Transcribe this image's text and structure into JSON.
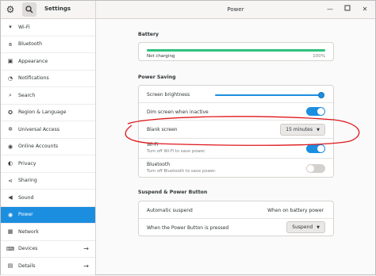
{
  "app_title": "Settings",
  "page_title": "Power",
  "sidebar": {
    "items": [
      {
        "label": "Wi-Fi",
        "icon": "wifi-icon",
        "glyph": "▾",
        "arrow": false,
        "active": false
      },
      {
        "label": "Bluetooth",
        "icon": "bluetooth-icon",
        "glyph": "ʙ",
        "arrow": false,
        "active": false
      },
      {
        "label": "Appearance",
        "icon": "appearance-icon",
        "glyph": "▣",
        "arrow": false,
        "active": false
      },
      {
        "label": "Notifications",
        "icon": "bell-icon",
        "glyph": "◔",
        "arrow": false,
        "active": false
      },
      {
        "label": "Search",
        "icon": "search-icon",
        "glyph": "⌕",
        "arrow": false,
        "active": false
      },
      {
        "label": "Region & Language",
        "icon": "region-icon",
        "glyph": "✪",
        "arrow": false,
        "active": false
      },
      {
        "label": "Universal Access",
        "icon": "accessibility-icon",
        "glyph": "✲",
        "arrow": false,
        "active": false
      },
      {
        "label": "Online Accounts",
        "icon": "online-accounts-icon",
        "glyph": "◉",
        "arrow": false,
        "active": false
      },
      {
        "label": "Privacy",
        "icon": "privacy-icon",
        "glyph": "◐",
        "arrow": false,
        "active": false
      },
      {
        "label": "Sharing",
        "icon": "sharing-icon",
        "glyph": "⋖",
        "arrow": false,
        "active": false
      },
      {
        "label": "Sound",
        "icon": "speaker-icon",
        "glyph": "◀",
        "arrow": false,
        "active": false
      },
      {
        "label": "Power",
        "icon": "power-icon",
        "glyph": "◉",
        "arrow": false,
        "active": true
      },
      {
        "label": "Network",
        "icon": "network-icon",
        "glyph": "▦",
        "arrow": false,
        "active": false
      },
      {
        "label": "Devices",
        "icon": "devices-icon",
        "glyph": "⌨",
        "arrow": true,
        "active": false
      },
      {
        "label": "Details",
        "icon": "details-icon",
        "glyph": "▤",
        "arrow": true,
        "active": false
      }
    ]
  },
  "battery": {
    "section_title": "Battery",
    "status": "Not charging",
    "percent_text": "100%",
    "level": 1.0
  },
  "power_saving": {
    "section_title": "Power Saving",
    "screen_brightness_label": "Screen brightness",
    "brightness_level": 1.0,
    "dim_screen_label": "Dim screen when inactive",
    "dim_screen_on": true,
    "blank_screen_label": "Blank screen",
    "blank_screen_value": "15 minutes",
    "wifi_label": "Wi-Fi",
    "wifi_sub": "Turn off Wi-Fi to save power.",
    "wifi_on": true,
    "bluetooth_label": "Bluetooth",
    "bluetooth_sub": "Turn off Bluetooth to save power.",
    "bluetooth_on": false
  },
  "suspend": {
    "section_title": "Suspend & Power Button",
    "auto_suspend_label": "Automatic suspend",
    "auto_suspend_value": "When on battery power",
    "power_button_label": "When the Power Button is pressed",
    "power_button_value": "Suspend"
  },
  "colors": {
    "accent": "#1c8ee0",
    "battery": "#2ec27e",
    "annotation": "#e0161b"
  }
}
